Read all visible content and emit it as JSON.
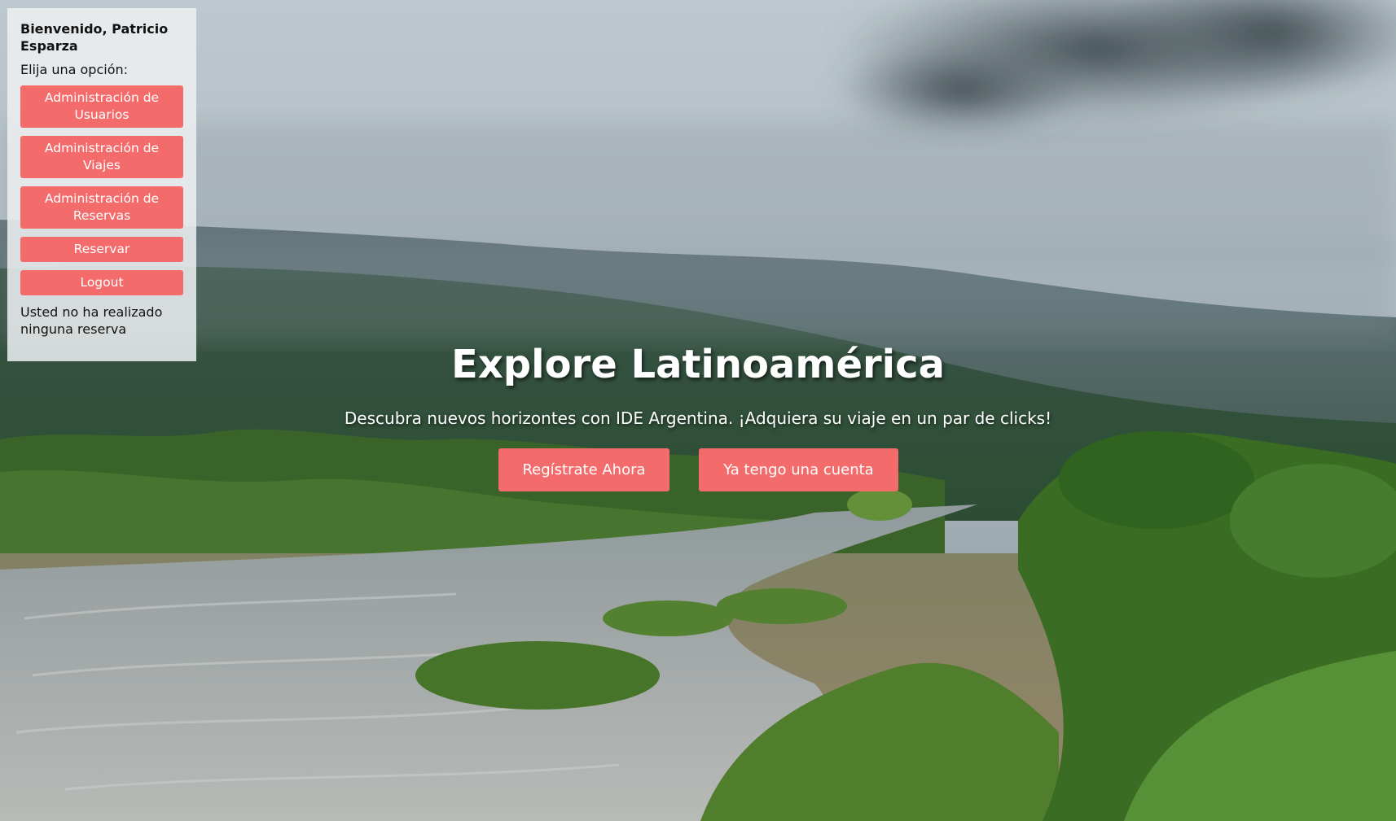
{
  "sidebar": {
    "welcome": "Bienvenido, Patricio Esparza",
    "prompt": "Elija una opción:",
    "menu": [
      {
        "label": "Administración de Usuarios"
      },
      {
        "label": "Administración de Viajes"
      },
      {
        "label": "Administración de Reservas"
      },
      {
        "label": "Reservar"
      },
      {
        "label": "Logout"
      }
    ],
    "status": "Usted no ha realizado ninguna reserva"
  },
  "hero": {
    "title": "Explore Latinoamérica",
    "subtitle": "Descubra nuevos horizontes con IDE Argentina. ¡Adquiera su viaje en un par de clicks!",
    "register_label": "Regístrate Ahora",
    "login_label": "Ya tengo una cuenta"
  },
  "colors": {
    "accent": "#f46b6b",
    "panel": "#eef0f2"
  }
}
